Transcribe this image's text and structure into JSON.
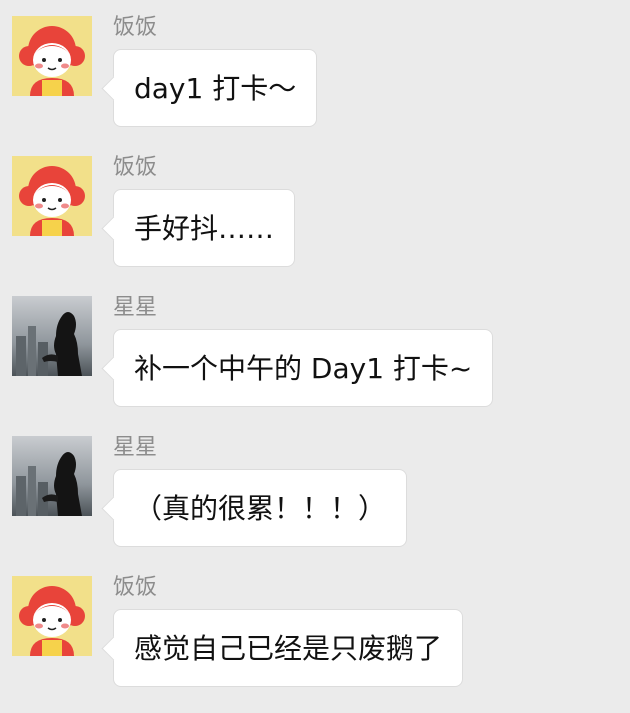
{
  "chat": {
    "messages": [
      {
        "sender": "饭饭",
        "avatar": "cartoon-girl-avatar",
        "text": "day1 打卡～"
      },
      {
        "sender": "饭饭",
        "avatar": "cartoon-girl-avatar",
        "text": "手好抖……"
      },
      {
        "sender": "星星",
        "avatar": "silhouette-photo-avatar",
        "text": "补一个中午的 Day1 打卡~"
      },
      {
        "sender": "星星",
        "avatar": "silhouette-photo-avatar",
        "text": "（真的很累！！！）"
      },
      {
        "sender": "饭饭",
        "avatar": "cartoon-girl-avatar",
        "text": "感觉自己已经是只废鹅了"
      }
    ]
  },
  "colors": {
    "background": "#ebebeb",
    "bubble": "#ffffff",
    "bubble_border": "#dcdcdc",
    "sender_name": "#8c8c8c",
    "avatar_cartoon_bg": "#f2e08a",
    "avatar_cartoon_hair": "#e8443a"
  }
}
